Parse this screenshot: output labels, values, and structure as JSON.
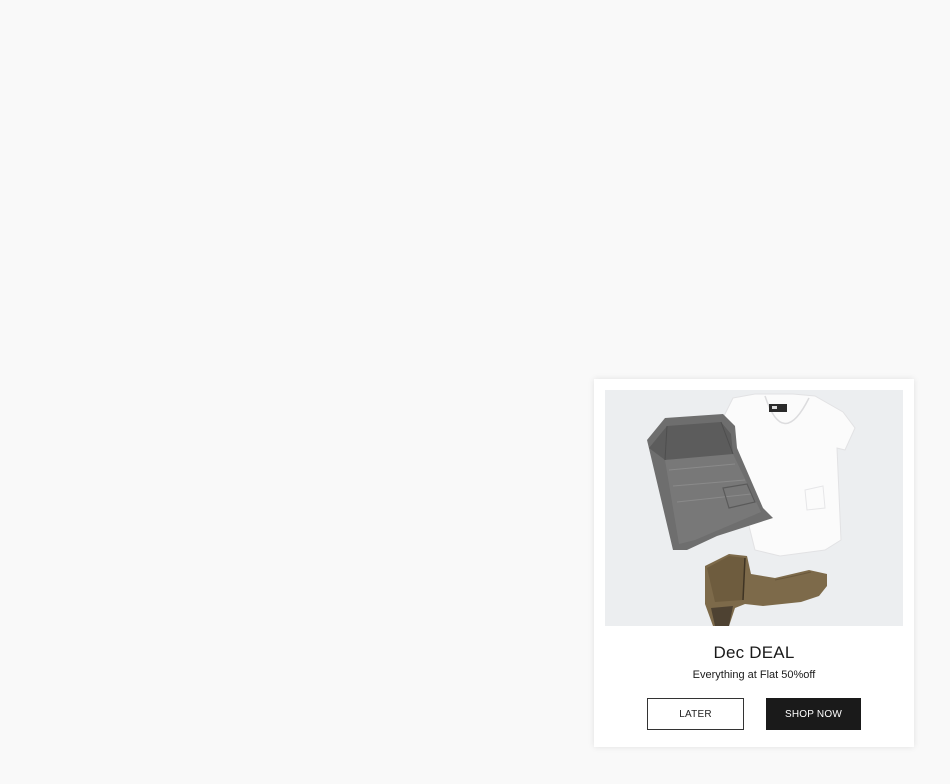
{
  "popup": {
    "title": "Dec DEAL",
    "subtitle": "Everything at Flat 50%off",
    "image_alt": "Folded grey jeans, white t-shirt and brown ankle boot",
    "buttons": {
      "later_label": "LATER",
      "shop_label": "SHOP NOW"
    }
  },
  "colors": {
    "page_background": "#f9f9f9",
    "popup_background": "#ffffff",
    "primary_button": "#1a1a1a",
    "text": "#1a1a1a"
  }
}
